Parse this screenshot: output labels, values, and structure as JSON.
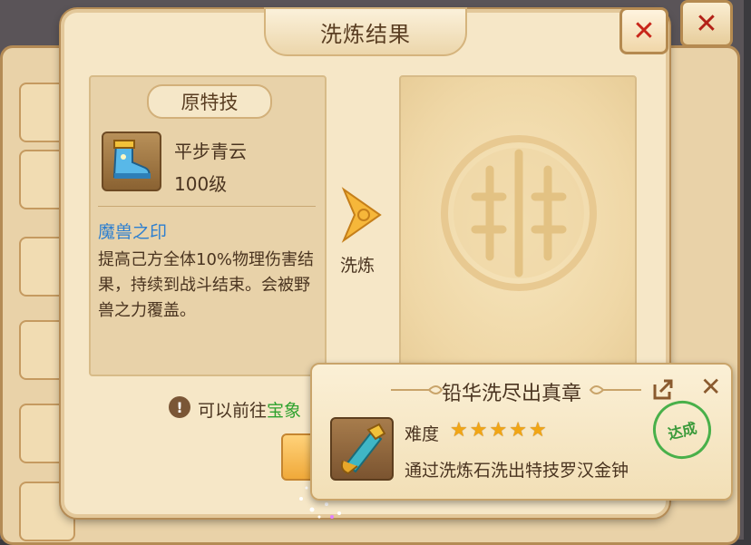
{
  "dialog": {
    "title": "洗炼结果",
    "close_icon": "✕"
  },
  "original": {
    "tag": "原特技",
    "item_name": "平步青云",
    "item_level": "100级",
    "skill_name": "魔兽之印",
    "skill_desc": "提高己方全体10%物理伤害结果，持续到战斗结束。会被野兽之力覆盖。"
  },
  "refine": {
    "label": "洗炼"
  },
  "hint": {
    "prefix": "可以前往",
    "link": "宝象"
  },
  "toast": {
    "title": "铅华洗尽出真章",
    "difficulty_label": "难度",
    "stars": [
      "★",
      "★",
      "★",
      "★",
      "★"
    ],
    "description": "通过洗炼石洗出特技罗汉金钟",
    "stamp": "达成",
    "close_icon": "✕"
  },
  "colors": {
    "skill_name": "#2d7fd0",
    "hint_link": "#2ea22e",
    "stamp": "#49b04a",
    "close": "#c8261a"
  }
}
